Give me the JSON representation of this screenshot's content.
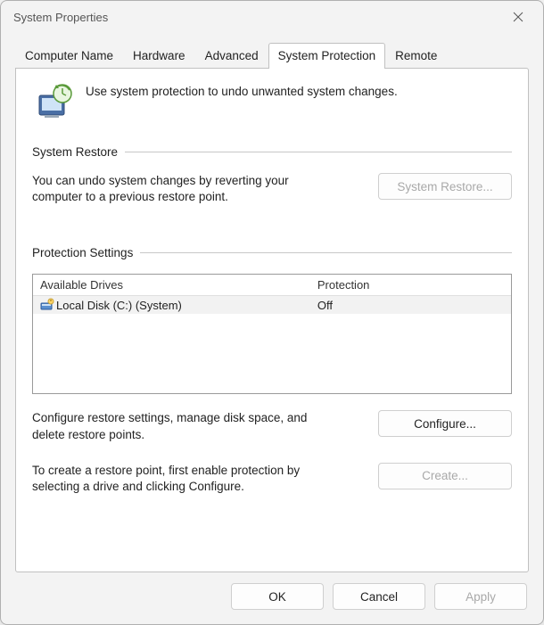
{
  "window": {
    "title": "System Properties"
  },
  "tabs": {
    "items": [
      {
        "label": "Computer Name"
      },
      {
        "label": "Hardware"
      },
      {
        "label": "Advanced"
      },
      {
        "label": "System Protection"
      },
      {
        "label": "Remote"
      }
    ],
    "active_index": 3
  },
  "intro": {
    "text": "Use system protection to undo unwanted system changes."
  },
  "system_restore": {
    "group_label": "System Restore",
    "description": "You can undo system changes by reverting your computer to a previous restore point.",
    "button_label": "System Restore...",
    "button_enabled": false
  },
  "protection_settings": {
    "group_label": "Protection Settings",
    "columns": {
      "drives": "Available Drives",
      "protection": "Protection"
    },
    "drives": [
      {
        "name": "Local Disk (C:) (System)",
        "protection": "Off"
      }
    ],
    "configure": {
      "description": "Configure restore settings, manage disk space, and delete restore points.",
      "button_label": "Configure...",
      "button_enabled": true
    },
    "create": {
      "description": "To create a restore point, first enable protection by selecting a drive and clicking Configure.",
      "button_label": "Create...",
      "button_enabled": false
    }
  },
  "footer": {
    "ok": "OK",
    "cancel": "Cancel",
    "apply": "Apply",
    "apply_enabled": false
  }
}
